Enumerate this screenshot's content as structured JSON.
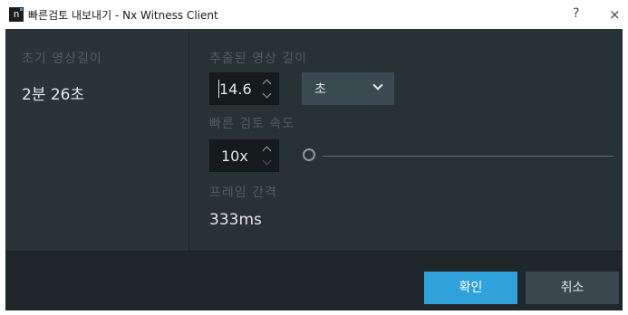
{
  "window": {
    "icon_letter": "n",
    "title": "빠른검토 내보내기 - Nx Witness Client",
    "help_label": "?",
    "close_label": "×"
  },
  "left": {
    "initial_length_label": "초기 영상길이",
    "initial_length_value": "2분 26초"
  },
  "right": {
    "extracted_length_label": "추출된 영상 길이",
    "extracted_length_value": "14.6",
    "unit_select_value": "초",
    "speed_label": "빠른 검토 속도",
    "speed_value": "10x",
    "frame_interval_label": "프레임 간격",
    "frame_interval_value": "333ms"
  },
  "footer": {
    "ok_label": "확인",
    "cancel_label": "취소"
  },
  "colors": {
    "accent": "#2fa2db",
    "panel": "#283134",
    "label": "#4f5d64"
  }
}
